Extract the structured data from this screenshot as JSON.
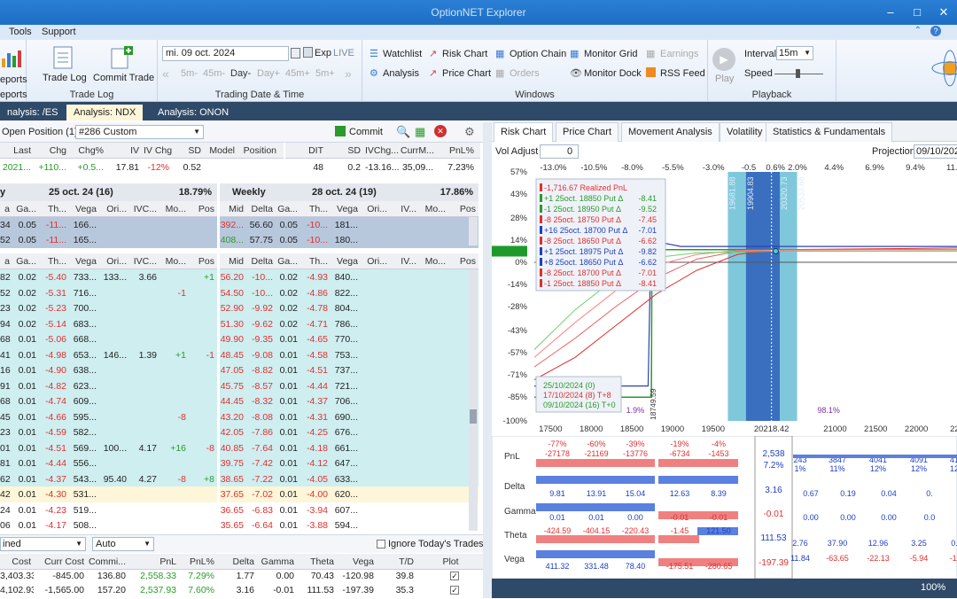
{
  "app": {
    "title": "OptionNET Explorer"
  },
  "menu": {
    "tools": "Tools",
    "support": "Support"
  },
  "ribbon": {
    "reports": "eports",
    "reports2": "eports",
    "trade_log": "Trade Log",
    "commit_trade": "Commit Trade",
    "trade_log_group": "Trade Log",
    "date_value": "mi. 09 oct. 2024",
    "exp": "Exp",
    "live": "LIVE",
    "steps": [
      "5m-",
      "45m-",
      "Day-",
      "Day+",
      "45m+",
      "5m+"
    ],
    "date_group": "Trading Date & Time",
    "windows": {
      "watchlist": "Watchlist",
      "risk_chart": "Risk Chart",
      "option_chain": "Option Chain",
      "monitor_grid": "Monitor Grid",
      "earnings": "Earnings",
      "analysis": "Analysis",
      "price_chart": "Price Chart",
      "orders": "Orders",
      "monitor_dock": "Monitor Dock",
      "rss_feed": "RSS Feed",
      "group": "Windows"
    },
    "playback": {
      "play": "Play",
      "interval_label": "Interval",
      "interval_value": "15m",
      "speed_label": "Speed",
      "group": "Playback"
    }
  },
  "doc_tabs": [
    {
      "label": "nalysis: /ES"
    },
    {
      "label": "Analysis: NDX"
    },
    {
      "label": "Analysis: ONON"
    }
  ],
  "position": {
    "label": "Open Position (1)",
    "name": "#286 Custom",
    "commit": "Commit"
  },
  "quote": {
    "headers": [
      "Last",
      "Chg",
      "Chg%",
      "IV",
      "IV Chg",
      "SD",
      "Model",
      "Position"
    ],
    "values": [
      "2021...",
      "+110...",
      "+0.5...",
      "17.81",
      "-12%",
      "0.52",
      "",
      ""
    ],
    "headers2": [
      "DIT",
      "SD",
      "IVChg...",
      "CurrM...",
      "PnL%"
    ],
    "values2": [
      "48",
      "0.2",
      "-13.16...",
      "35,09...",
      "7.23%"
    ]
  },
  "chain_left": {
    "title_prefix": "y",
    "date": "25 oct. 24 (16)",
    "iv": "18.79%",
    "top_headers": [
      "a",
      "Ga...",
      "Th...",
      "Vega",
      "Ori...",
      "IVC...",
      "Mo...",
      "Pos"
    ],
    "top_rows": [
      [
        "34",
        "0.05",
        "-11...",
        "166...",
        "",
        "",
        "",
        ""
      ],
      [
        "52",
        "0.05",
        "-11...",
        "165...",
        "",
        "",
        "",
        ""
      ]
    ],
    "headers": [
      "a",
      "Ga...",
      "Th...",
      "Vega",
      "Ori...",
      "IVC...",
      "Mo...",
      "Pos"
    ],
    "rows": [
      [
        "82",
        "0.02",
        "-5.40",
        "733...",
        "133...",
        "3.66",
        "",
        "+1"
      ],
      [
        "52",
        "0.02",
        "-5.31",
        "716...",
        "",
        "",
        "-1",
        ""
      ],
      [
        "23",
        "0.02",
        "-5.23",
        "700...",
        "",
        "",
        "",
        ""
      ],
      [
        "94",
        "0.02",
        "-5.14",
        "683...",
        "",
        "",
        "",
        ""
      ],
      [
        "68",
        "0.01",
        "-5.06",
        "668...",
        "",
        "",
        "",
        ""
      ],
      [
        "41",
        "0.01",
        "-4.98",
        "653...",
        "146...",
        "1.39",
        "+1",
        "-1"
      ],
      [
        "16",
        "0.01",
        "-4.90",
        "638...",
        "",
        "",
        "",
        ""
      ],
      [
        "91",
        "0.01",
        "-4.82",
        "623...",
        "",
        "",
        "",
        ""
      ],
      [
        "68",
        "0.01",
        "-4.74",
        "609...",
        "",
        "",
        "",
        ""
      ],
      [
        "45",
        "0.01",
        "-4.66",
        "595...",
        "",
        "",
        "-8",
        ""
      ],
      [
        "23",
        "0.01",
        "-4.59",
        "582...",
        "",
        "",
        "",
        ""
      ],
      [
        "01",
        "0.01",
        "-4.51",
        "569...",
        "100...",
        "4.17",
        "+16",
        "-8"
      ],
      [
        "81",
        "0.01",
        "-4.44",
        "556...",
        "",
        "",
        "",
        ""
      ],
      [
        "62",
        "0.01",
        "-4.37",
        "543...",
        "95.40",
        "4.27",
        "-8",
        "+8"
      ],
      [
        "42",
        "0.01",
        "-4.30",
        "531...",
        "",
        "",
        "",
        ""
      ],
      [
        "24",
        "0.01",
        "-4.23",
        "519...",
        "",
        "",
        "",
        ""
      ],
      [
        "06",
        "0.01",
        "-4.17",
        "508...",
        "",
        "",
        "",
        ""
      ],
      [
        "88",
        "0.01",
        "-4.10",
        "496...",
        "",
        "",
        "",
        ""
      ]
    ]
  },
  "chain_right": {
    "title": "Weekly",
    "date": "28 oct. 24 (19)",
    "iv": "17.86%",
    "top_headers": [
      "Mid",
      "Delta",
      "Ga...",
      "Th...",
      "Vega",
      "Ori...",
      "IV...",
      "Mo...",
      "Pos"
    ],
    "top_rows": [
      [
        "392...",
        "56.60",
        "0.05",
        "-10...",
        "181...",
        "",
        "",
        "",
        ""
      ],
      [
        "408...",
        "57.75",
        "0.05",
        "-10...",
        "180...",
        "",
        "",
        "",
        ""
      ]
    ],
    "headers": [
      "Mid",
      "Delta",
      "Ga...",
      "Th...",
      "Vega",
      "Ori...",
      "IV...",
      "Mo...",
      "Pos"
    ],
    "rows": [
      [
        "56.20",
        "-10...",
        "0.02",
        "-4.93",
        "840..."
      ],
      [
        "54.50",
        "-10...",
        "0.02",
        "-4.86",
        "822..."
      ],
      [
        "52.90",
        "-9.92",
        "0.02",
        "-4.78",
        "804..."
      ],
      [
        "51.30",
        "-9.62",
        "0.02",
        "-4.71",
        "786..."
      ],
      [
        "49.90",
        "-9.35",
        "0.01",
        "-4.65",
        "770..."
      ],
      [
        "48.45",
        "-9.08",
        "0.01",
        "-4.58",
        "753..."
      ],
      [
        "47.05",
        "-8.82",
        "0.01",
        "-4.51",
        "737..."
      ],
      [
        "45.75",
        "-8.57",
        "0.01",
        "-4.44",
        "721..."
      ],
      [
        "44.45",
        "-8.32",
        "0.01",
        "-4.37",
        "706..."
      ],
      [
        "43.20",
        "-8.08",
        "0.01",
        "-4.31",
        "690..."
      ],
      [
        "42.05",
        "-7.86",
        "0.01",
        "-4.25",
        "676..."
      ],
      [
        "40.85",
        "-7.64",
        "0.01",
        "-4.18",
        "661..."
      ],
      [
        "39.75",
        "-7.42",
        "0.01",
        "-4.12",
        "647..."
      ],
      [
        "38.65",
        "-7.22",
        "0.01",
        "-4.05",
        "633..."
      ],
      [
        "37.65",
        "-7.02",
        "0.01",
        "-4.00",
        "620..."
      ],
      [
        "36.65",
        "-6.83",
        "0.01",
        "-3.94",
        "607..."
      ],
      [
        "35.65",
        "-6.64",
        "0.01",
        "-3.88",
        "594..."
      ],
      [
        "34.75",
        "-6.46",
        "0.01",
        "-3.82",
        "581..."
      ]
    ]
  },
  "bottom": {
    "combined": "ined",
    "auto": "Auto",
    "ignore_today": "Ignore Today's Trades",
    "headers": [
      "Cost",
      "Curr Cost",
      "Commi...",
      "PnL",
      "PnL%",
      "Delta",
      "Gamma",
      "Theta",
      "Vega",
      "T/D",
      "Plot"
    ],
    "rows": [
      [
        "3,403.33",
        "-845.00",
        "136.80",
        "2,558.33",
        "7.29%",
        "1.77",
        "0.00",
        "70.43",
        "-120.98",
        "39.8",
        "✓"
      ],
      [
        "4,102.93",
        "-1,565.00",
        "157.20",
        "2,537.93",
        "7.60%",
        "3.16",
        "-0.01",
        "111.53",
        "-197.39",
        "35.3",
        "✓"
      ]
    ]
  },
  "right_tabs": [
    "Risk Chart",
    "Price Chart",
    "Movement Analysis",
    "Volatility",
    "Statistics & Fundamentals"
  ],
  "risk": {
    "vol_adjust_label": "Vol Adjust",
    "vol_adjust_value": "0",
    "projection_label": "Projection",
    "projection_value": "09/10/202",
    "top_pcts": [
      "-13.0%",
      "-10.5%",
      "-8.0%",
      "-5.5%",
      "-3.0%",
      "-0.5",
      "0.6%",
      "2.0%",
      "4.4%",
      "6.9%",
      "9.4%",
      "11.9"
    ],
    "y_ticks": [
      "57%",
      "43%",
      "28%",
      "14%",
      "7%",
      "0%",
      "-14%",
      "-28%",
      "-43%",
      "-57%",
      "-71%",
      "-85%",
      "-100%"
    ],
    "x_ticks": [
      "17500",
      "18000",
      "18500",
      "19000",
      "19500",
      "20218.42",
      "21000",
      "21500",
      "22000",
      "225"
    ],
    "band_labels": [
      "19681.88",
      "19904.83",
      "20320.73",
      "20533.88"
    ],
    "legend": [
      {
        "text": "-1,716.67 Realized PnL",
        "color": "#e03030"
      },
      {
        "text": "+1 25oct. 18850 Put Δ",
        "val": "-8.41",
        "color": "#2a9a2a"
      },
      {
        "text": "-1 25oct. 18950 Put Δ",
        "val": "-9.52",
        "color": "#2a9a2a"
      },
      {
        "text": "-8 25oct. 18750 Put Δ",
        "val": "-7.45",
        "color": "#e03030"
      },
      {
        "text": "+16 25oct. 18700 Put Δ",
        "val": "-7.01",
        "color": "#2040c0"
      },
      {
        "text": "-8 25oct. 18650 Put Δ",
        "val": "-6.62",
        "color": "#e03030"
      },
      {
        "text": "+1 25oct. 18975 Put Δ",
        "val": "-9.82",
        "color": "#2040c0"
      },
      {
        "text": "+8 25oct. 18650 Put Δ",
        "val": "-6.62",
        "color": "#2040c0"
      },
      {
        "text": "-8 25oct. 18700 Put Δ",
        "val": "-7.01",
        "color": "#e03030"
      },
      {
        "text": "-1 25oct. 18850 Put Δ",
        "val": "-8.41",
        "color": "#e03030"
      }
    ],
    "legend2": [
      {
        "text": "25/10/2024 (0)",
        "color": "#2a9a2a"
      },
      {
        "text": "17/10/2024 (8) T+8",
        "color": "#e03030"
      },
      {
        "text": "09/10/2024 (16) T+0",
        "color": "#2a9a2a"
      }
    ],
    "pct_small": "1.9%",
    "pct_98": "98.1%",
    "strike_marker": "18749.59"
  },
  "greeks": {
    "labels": [
      "PnL",
      "Delta",
      "Gamma",
      "Theta",
      "Vega"
    ],
    "pnl_top": [
      "-77%",
      "-60%",
      "-39%",
      "-19%",
      "-4%"
    ],
    "pnl_vals": [
      "-27178",
      "-21169",
      "-13776",
      "-6734",
      "-1453"
    ],
    "pnl_center": "2,538",
    "pnl_center_pct": "7.2%",
    "pnl_right_vals": [
      "243",
      "3847",
      "4041",
      "4091",
      "41"
    ],
    "pnl_right_pcts": [
      "1%",
      "11%",
      "12%",
      "12%",
      "12"
    ],
    "delta_vals": [
      "9.81",
      "13.91",
      "15.04",
      "12.63",
      "8.39"
    ],
    "delta_center": "3.16",
    "delta_right": [
      "0.67",
      "0.19",
      "0.04",
      "0."
    ],
    "gamma_vals": [
      "0.01",
      "0.01",
      "0.00",
      "-0.01",
      "-0.01"
    ],
    "gamma_center": "-0.01",
    "gamma_right": [
      "0.00",
      "0.00",
      "0.00",
      "0.0"
    ],
    "theta_vals": [
      "-424.59",
      "-404.15",
      "-220.43",
      "-1.45",
      "121.50"
    ],
    "theta_center": "111.53",
    "theta_right": [
      "2.76",
      "37.90",
      "12.96",
      "3.25",
      "0."
    ],
    "vega_vals": [
      "411.32",
      "331.48",
      "78.40",
      "-175.51",
      "-280.65"
    ],
    "vega_center": "-197.39",
    "vega_right": [
      "11.84",
      "-63.65",
      "-22.13",
      "-5.94",
      "-1."
    ]
  },
  "status": {
    "zoom": "100%"
  }
}
